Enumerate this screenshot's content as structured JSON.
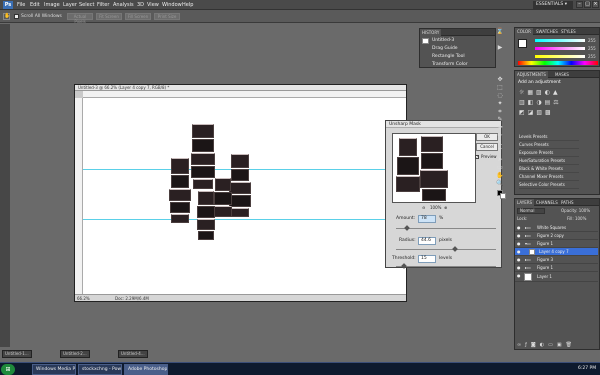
{
  "menubar": {
    "logo": "Ps",
    "items": [
      "File",
      "Edit",
      "Image",
      "Layer",
      "Select",
      "Filter",
      "Analysis",
      "3D",
      "View",
      "Window",
      "Help"
    ],
    "workspace": "ESSENTIALS ▾",
    "controls": [
      "–",
      "□",
      "×"
    ]
  },
  "options": {
    "scroll_all_label": "Scroll All Windows",
    "buttons": [
      "Actual Pixels",
      "Fit Screen",
      "Fill Screen",
      "Print Size"
    ]
  },
  "document": {
    "title": "Untitled-3 @ 66.2% (Layer 4 copy 7, RGB/8) *",
    "zoom": "66.2%",
    "status": "Doc: 2.29M/6.4M"
  },
  "dialog": {
    "title": "Unsharp Mask",
    "ok": "OK",
    "cancel": "Cancel",
    "preview_label": "Preview",
    "zoom": "100%",
    "amount_label": "Amount:",
    "amount_value": "78",
    "amount_unit": "%",
    "radius_label": "Radius:",
    "radius_value": "44.6",
    "radius_unit": "pixels",
    "threshold_label": "Threshold:",
    "threshold_value": "15",
    "threshold_unit": "levels"
  },
  "history": {
    "tab": "HISTORY",
    "items": [
      "Untitled-3",
      "Drag Guide",
      "Rectangle Tool",
      "Transform Color"
    ]
  },
  "color": {
    "tabs": [
      "COLOR",
      "SWATCHES",
      "STYLES"
    ],
    "r": "255",
    "g": "255",
    "b": "255"
  },
  "adjustments": {
    "tabs": [
      "ADJUSTMENTS",
      "MASKS"
    ],
    "header": "Add an adjustment",
    "items": [
      "Levels Presets",
      "Curves Presets",
      "Exposure Presets",
      "Hue/Saturation Presets",
      "Black & White Presets",
      "Channel Mixer Presets",
      "Selective Color Presets"
    ]
  },
  "layers": {
    "tabs": [
      "LAYERS",
      "CHANNELS",
      "PATHS"
    ],
    "mode": "Normal",
    "opacity": "Opacity: 100%",
    "lock": "Lock:",
    "fill": "Fill: 100%",
    "items": [
      "White Squares",
      "Figure 2 copy",
      "Figure 1",
      "Layer 4 copy 7",
      "Figure 3",
      "Figure 1",
      "Layer 1"
    ]
  },
  "minidocs": [
    "Untitled-1...",
    "Untitled-2...",
    "Untitled-4..."
  ],
  "taskbar": {
    "start": "⊞",
    "tasks": [
      "Windows Media Player",
      "stockxchng - Power...",
      "Adobe Photoshop C..."
    ],
    "clock": "6:27 PM"
  },
  "colors": {
    "accent": "#3a6fd8",
    "guide": "#5ad0e8",
    "panel": "#535353"
  }
}
